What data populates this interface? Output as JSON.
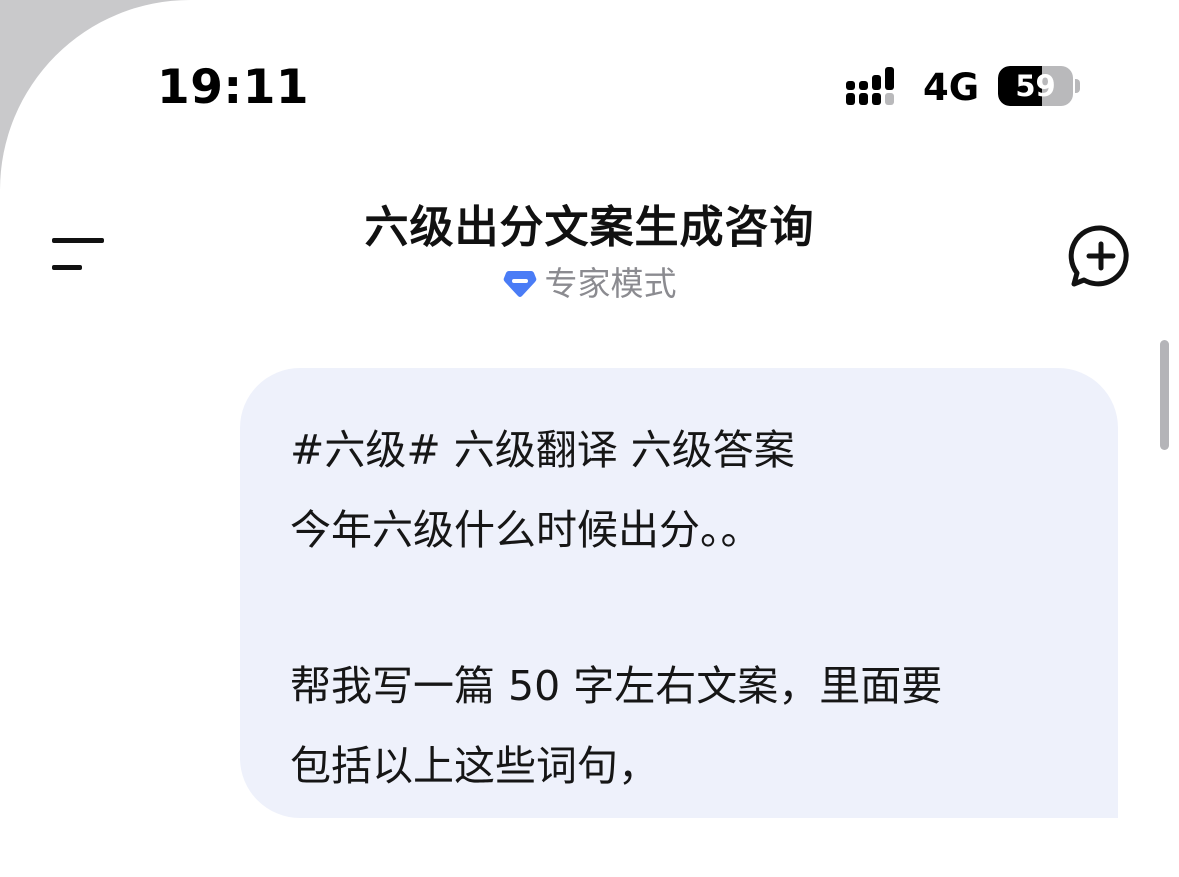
{
  "status_bar": {
    "time": "19:11",
    "network": "4G",
    "battery_level": "59",
    "battery_fraction": 0.59
  },
  "header": {
    "menu_icon": "menu-icon",
    "title": "六级出分文案生成咨询",
    "mode_label": "专家模式",
    "mode_icon": "diamond-icon",
    "mode_icon_color": "#4a7cf6",
    "new_chat_icon": "new-chat-icon"
  },
  "messages": [
    {
      "role": "user",
      "lines": [
        "#六级# 六级翻译 六级答案",
        "今年六级什么时候出分。。",
        "",
        "帮我写一篇 50 字左右文案，里面要",
        "包括以上这些词句，"
      ]
    }
  ],
  "colors": {
    "bubble_bg": "#eef1fb",
    "background": "#ffffff",
    "muted_text": "#8b8b90"
  }
}
